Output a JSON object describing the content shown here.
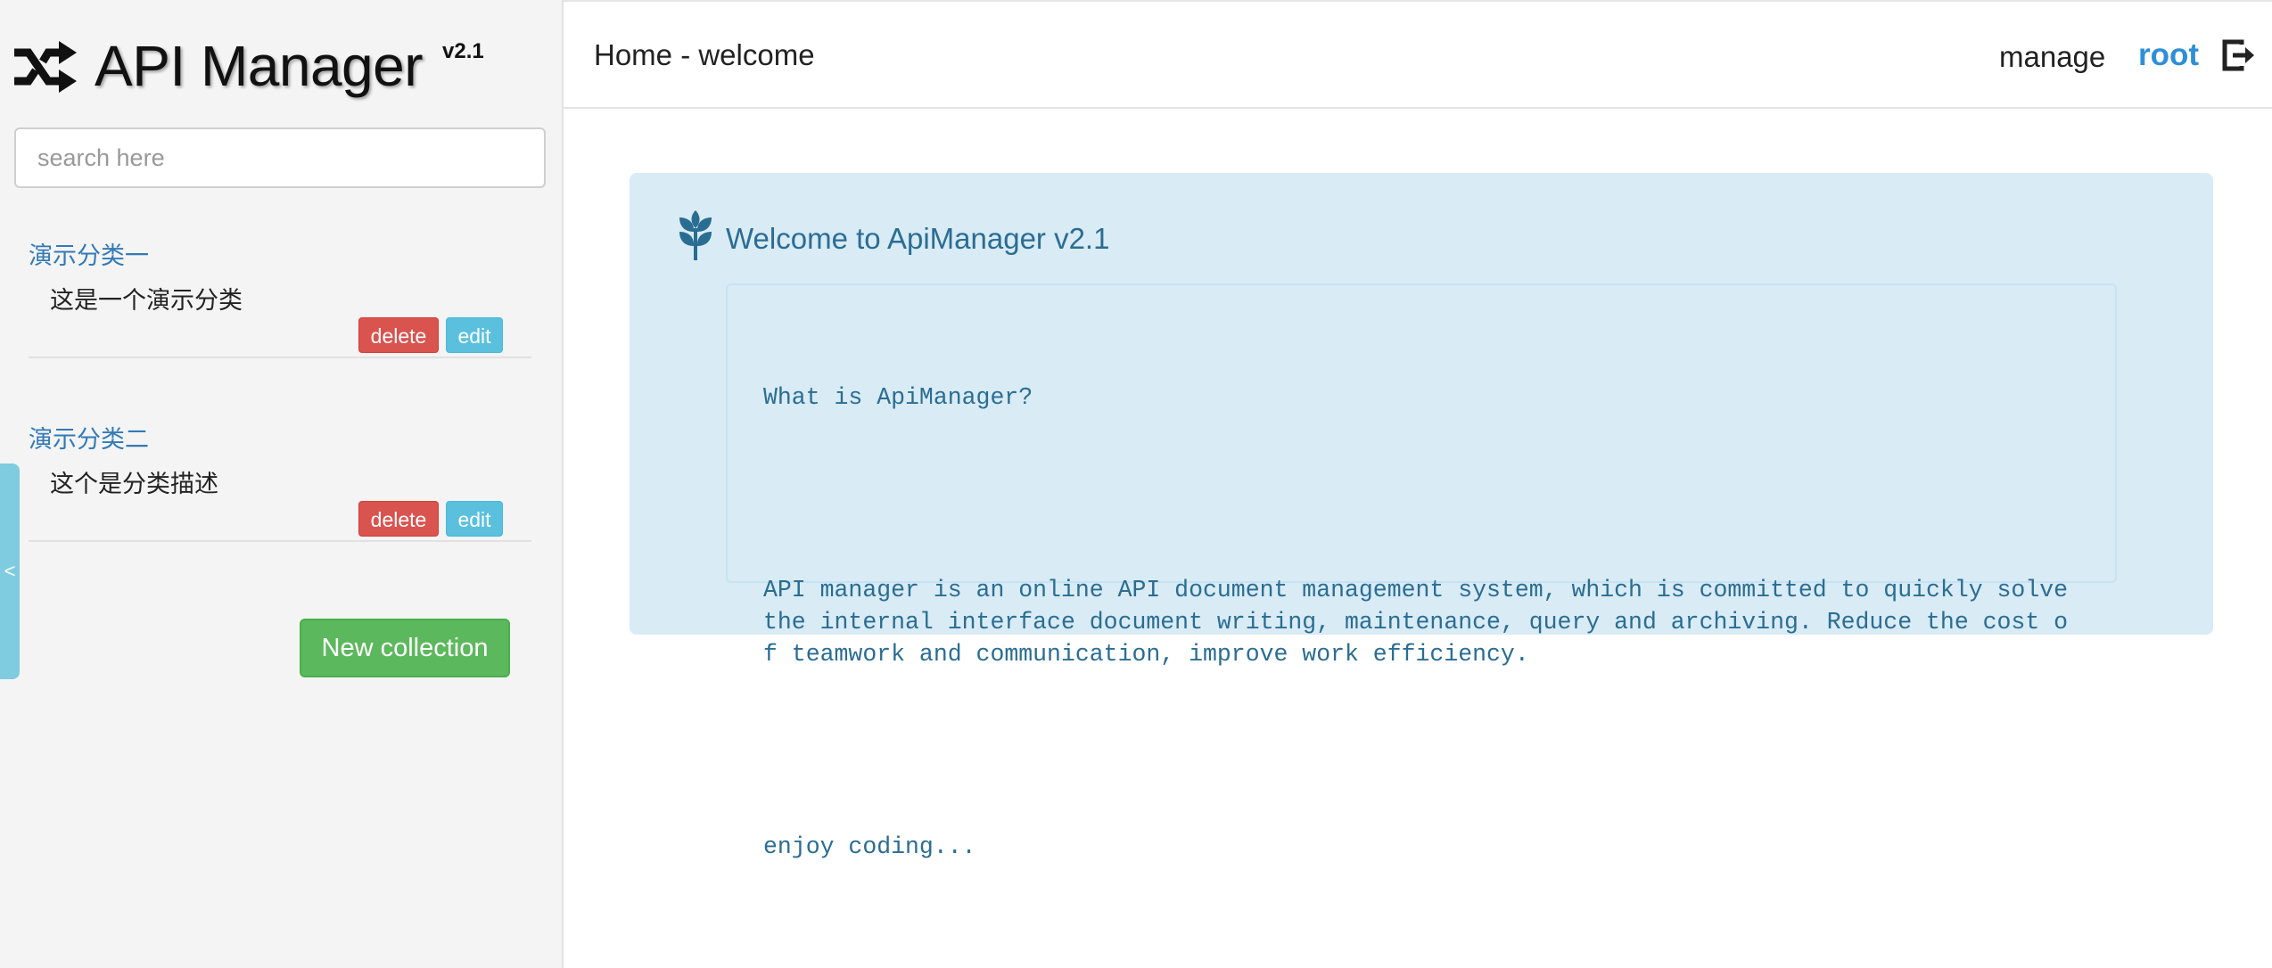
{
  "app": {
    "title": "API Manager",
    "version": "v2.1"
  },
  "search": {
    "placeholder": "search here",
    "value": ""
  },
  "collections": [
    {
      "name": "演示分类一",
      "description": "这是一个演示分类",
      "delete_label": "delete",
      "edit_label": "edit"
    },
    {
      "name": "演示分类二",
      "description": "这个是分类描述",
      "delete_label": "delete",
      "edit_label": "edit"
    }
  ],
  "sidebar": {
    "new_collection_label": "New collection",
    "collapse_label": "<"
  },
  "header": {
    "breadcrumb": "Home - welcome",
    "manage_label": "manage",
    "username": "root"
  },
  "welcome": {
    "title": "Welcome to ApiManager v2.1",
    "question": "What is ApiManager?",
    "body": "API manager is an online API document management system, which is committed to quickly solve the internal interface document writing, maintenance, query and archiving. Reduce the cost of teamwork and communication, improve work efficiency.",
    "footer": "enjoy coding..."
  },
  "icons": {
    "logo": "shuffle-icon",
    "logout": "sign-out-icon",
    "welcome": "leaf-icon"
  },
  "colors": {
    "link": "#337ab7",
    "user": "#2e8fd6",
    "delete": "#d9534f",
    "edit": "#5bc0de",
    "success": "#5cb85c",
    "info_bg": "#d9ebf5",
    "info_text": "#2a6d93"
  }
}
